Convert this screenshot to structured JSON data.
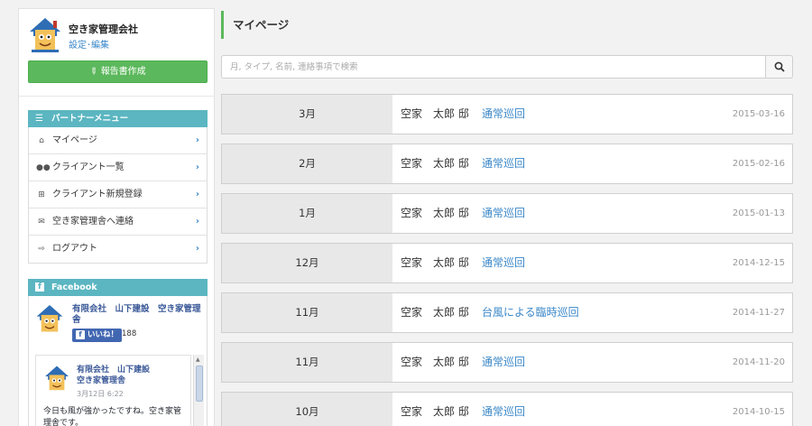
{
  "colors": {
    "accent_green": "#5cb85c",
    "panel_teal": "#5bb6c1",
    "link_blue": "#3a87c8",
    "facebook_blue": "#3b5998"
  },
  "sidebar": {
    "company_name": "空き家管理会社",
    "edit_link": "設定･編集",
    "report_button": "報告書作成",
    "report_button_icon": "pencil-icon",
    "menu_title": "パートナーメニュー",
    "menu_title_icon": "list-icon",
    "menu_items": [
      {
        "label": "マイページ",
        "icon": "home-icon"
      },
      {
        "label": "クライアント一覧",
        "icon": "users-icon"
      },
      {
        "label": "クライアント新規登録",
        "icon": "plus-square-icon"
      },
      {
        "label": "空き家管理舎へ連絡",
        "icon": "envelope-icon"
      },
      {
        "label": "ログアウト",
        "icon": "sign-out-icon"
      }
    ],
    "facebook": {
      "title": "Facebook",
      "page_name": "有限会社　山下建設　空き家管理舎",
      "like_label": "いいね！",
      "like_count": "188",
      "post": {
        "author_line1": "有限会社　山下建設",
        "author_line2": "空き家管理舎",
        "date": "3月12日 6:22",
        "text": "今日も風が強かったですね。空き家管理舎です。"
      }
    }
  },
  "main": {
    "title": "マイページ",
    "search": {
      "placeholder": "月, タイプ, 名前, 連絡事項で検索",
      "value": ""
    },
    "reports": [
      {
        "month": "3月",
        "client": "空家　太郎 邸",
        "type": "通常巡回",
        "date": "2015-03-16"
      },
      {
        "month": "2月",
        "client": "空家　太郎 邸",
        "type": "通常巡回",
        "date": "2015-02-16"
      },
      {
        "month": "1月",
        "client": "空家　太郎 邸",
        "type": "通常巡回",
        "date": "2015-01-13"
      },
      {
        "month": "12月",
        "client": "空家　太郎 邸",
        "type": "通常巡回",
        "date": "2014-12-15"
      },
      {
        "month": "11月",
        "client": "空家　太郎 邸",
        "type": "台風による臨時巡回",
        "date": "2014-11-27"
      },
      {
        "month": "11月",
        "client": "空家　太郎 邸",
        "type": "通常巡回",
        "date": "2014-11-20"
      },
      {
        "month": "10月",
        "client": "空家　太郎 邸",
        "type": "通常巡回",
        "date": "2014-10-15"
      }
    ]
  }
}
